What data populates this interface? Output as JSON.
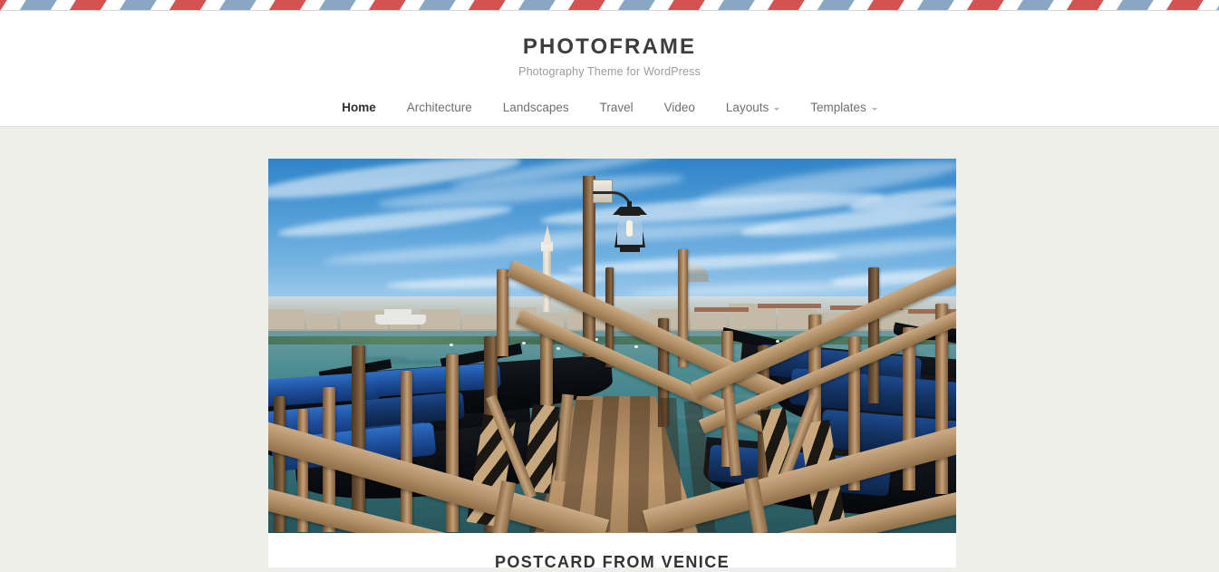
{
  "decor": {
    "airmail_border_name": "airmail-stripe-border",
    "airmail_red": "#cf3a3a",
    "airmail_blue": "#6f94b5",
    "page_background": "#eeefe9",
    "card_background": "#ffffff"
  },
  "header": {
    "site_title": "PHOTOFRAME",
    "tagline": "Photography Theme for WordPress",
    "title_color": "#3d3d3d",
    "tagline_color": "#9b9b9b"
  },
  "nav": {
    "items": [
      {
        "label": "Home",
        "active": true,
        "has_dropdown": false
      },
      {
        "label": "Architecture",
        "active": false,
        "has_dropdown": false
      },
      {
        "label": "Landscapes",
        "active": false,
        "has_dropdown": false
      },
      {
        "label": "Travel",
        "active": false,
        "has_dropdown": false
      },
      {
        "label": "Video",
        "active": false,
        "has_dropdown": false
      },
      {
        "label": "Layouts",
        "active": false,
        "has_dropdown": true
      },
      {
        "label": "Templates",
        "active": false,
        "has_dropdown": true
      }
    ]
  },
  "post": {
    "title": "POSTCARD FROM VENICE",
    "featured_image_alt": "Venice lagoon with moored gondolas, wooden pier and San Giorgio Maggiore campanile"
  }
}
